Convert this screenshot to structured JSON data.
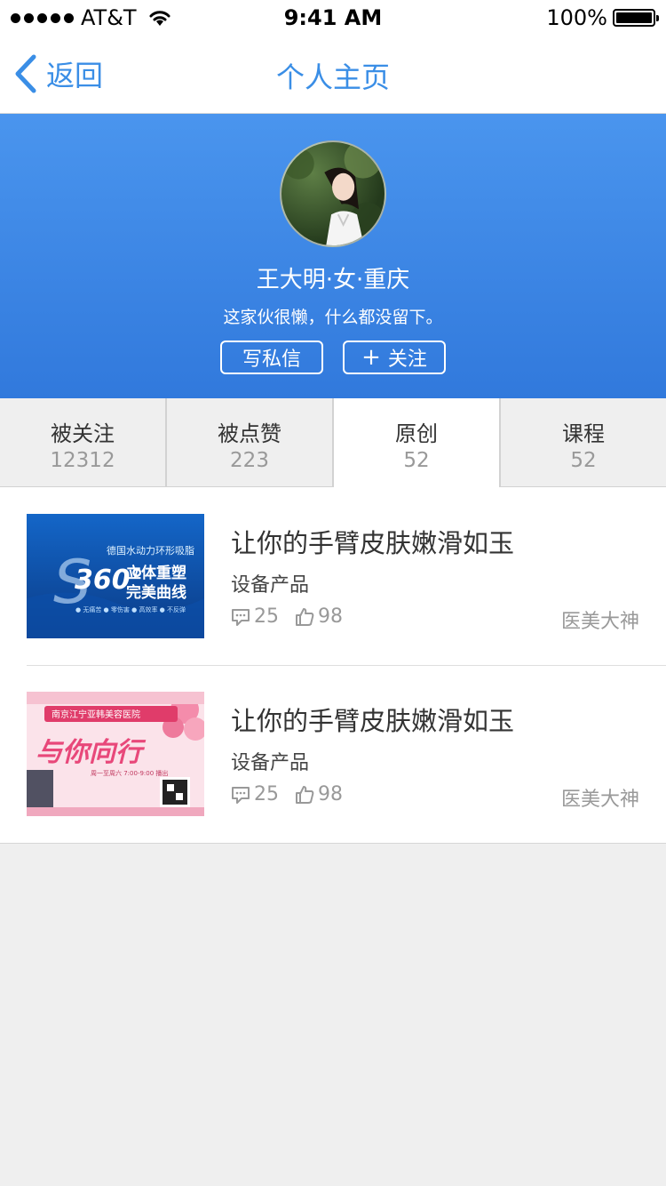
{
  "status_bar": {
    "carrier": "AT&T",
    "time": "9:41 AM",
    "battery": "100%"
  },
  "nav": {
    "back_label": "返回",
    "title": "个人主页"
  },
  "profile": {
    "name": "王大明·女·重庆",
    "bio": "这家伙很懒，什么都没留下。",
    "message_button": "写私信",
    "follow_button": "关注",
    "accent_color": "#3a8ee6"
  },
  "stats": [
    {
      "label": "被关注",
      "value": "12312"
    },
    {
      "label": "被点赞",
      "value": "223"
    },
    {
      "label": "原创",
      "value": "52"
    },
    {
      "label": "课程",
      "value": "52"
    }
  ],
  "posts": [
    {
      "title": "让你的手臂皮肤嫩滑如玉",
      "category": "设备产品",
      "comments": "25",
      "likes": "98",
      "author": "医美大神",
      "thumb_text": {
        "line1": "德国水动力环形吸脂",
        "big": "360°",
        "line2": "立体重塑",
        "line3": "完美曲线",
        "tags": "● 无痛苦  ● 零伤害  ● 高效率  ● 不反弹"
      }
    },
    {
      "title": "让你的手臂皮肤嫩滑如玉",
      "category": "设备产品",
      "comments": "25",
      "likes": "98",
      "author": "医美大神",
      "thumb_text": {
        "header": "南京江宁亚韩美容医院",
        "big": "与你向行",
        "time": "周一至周六 7:00-9:00 播出"
      }
    }
  ]
}
